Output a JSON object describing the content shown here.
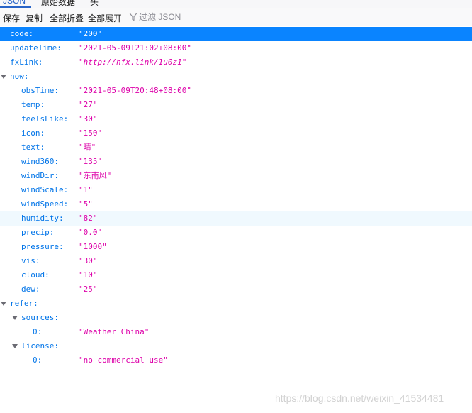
{
  "tabs": {
    "json": "JSON",
    "raw": "原始数据",
    "headers": "头"
  },
  "toolbar": {
    "save": "保存",
    "copy": "复制",
    "collapse_all": "全部折叠",
    "expand_all": "全部展开",
    "filter_placeholder": "过滤 JSON"
  },
  "tree": {
    "code": {
      "key": "code:",
      "value": "\"200\""
    },
    "updateTime": {
      "key": "updateTime:",
      "value": "\"2021-05-09T21:02+08:00\""
    },
    "fxLink": {
      "key": "fxLink:",
      "value": "\"http://hfx.link/1u0z1\""
    },
    "now": {
      "key": "now:",
      "obsTime": {
        "key": "obsTime:",
        "value": "\"2021-05-09T20:48+08:00\""
      },
      "temp": {
        "key": "temp:",
        "value": "\"27\""
      },
      "feelsLike": {
        "key": "feelsLike:",
        "value": "\"30\""
      },
      "icon": {
        "key": "icon:",
        "value": "\"150\""
      },
      "text": {
        "key": "text:",
        "value": "\"晴\""
      },
      "wind360": {
        "key": "wind360:",
        "value": "\"135\""
      },
      "windDir": {
        "key": "windDir:",
        "value": "\"东南风\""
      },
      "windScale": {
        "key": "windScale:",
        "value": "\"1\""
      },
      "windSpeed": {
        "key": "windSpeed:",
        "value": "\"5\""
      },
      "humidity": {
        "key": "humidity:",
        "value": "\"82\""
      },
      "precip": {
        "key": "precip:",
        "value": "\"0.0\""
      },
      "pressure": {
        "key": "pressure:",
        "value": "\"1000\""
      },
      "vis": {
        "key": "vis:",
        "value": "\"30\""
      },
      "cloud": {
        "key": "cloud:",
        "value": "\"10\""
      },
      "dew": {
        "key": "dew:",
        "value": "\"25\""
      }
    },
    "refer": {
      "key": "refer:",
      "sources": {
        "key": "sources:",
        "items": [
          {
            "key": "0:",
            "value": "\"Weather China\""
          }
        ]
      },
      "license": {
        "key": "license:",
        "items": [
          {
            "key": "0:",
            "value": "\"no commercial use\""
          }
        ]
      }
    }
  },
  "watermark": "https://blog.csdn.net/weixin_41534481",
  "colors": {
    "key": "#0074e8",
    "string_value": "#dd00a9",
    "selected_row": "#0a84ff",
    "hover_row": "#f0f9fe",
    "active_tab": "#2864c8"
  }
}
